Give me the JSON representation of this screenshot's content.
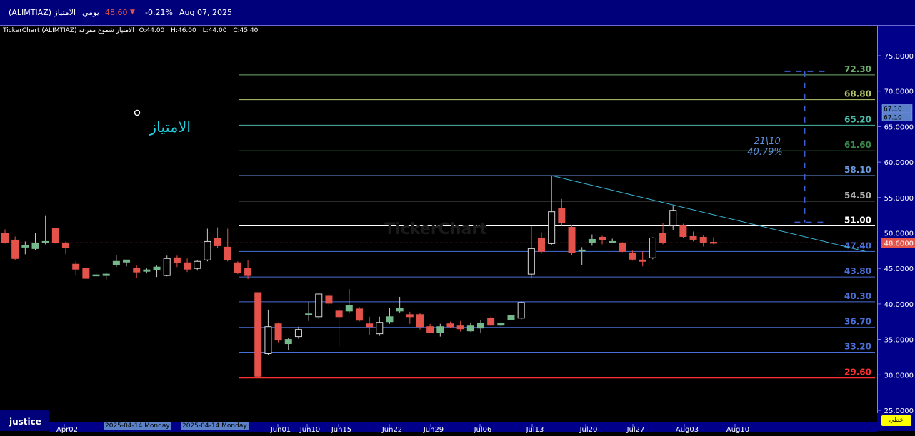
{
  "header": {
    "symbol": "(ALIMTIAZ) الامتياز",
    "period": "يومي",
    "price": "48.60",
    "change": "-0.21%",
    "date": "Aug 07, 2025"
  },
  "ohlc": {
    "brand": "TickerChart (ALIMTIAZ) الامتياز شموع مفرغة",
    "open": "O:44.00",
    "high": "H:46.00",
    "low": "L:44.00",
    "close": "C:45.40"
  },
  "watermark": "TickerChart",
  "chart_label": "الامتياز",
  "measure": {
    "bars": "21\\10",
    "pct": "40.79%"
  },
  "last_price_tag": "48.6000",
  "right_tags": [
    "67.10",
    "67.10"
  ],
  "footer": {
    "button": "justice",
    "corner_button": "خطي"
  },
  "date_boxes": [
    "2025-04-14 Monday",
    "2025-04-14 Monday"
  ],
  "colors": {
    "background": "#000000",
    "bar_blue": "#00007a",
    "up": "#74b98b",
    "down": "#e4534b",
    "price_tag": "#e4534b"
  },
  "chart_data": {
    "type": "candlestick",
    "ylim": [
      25,
      77
    ],
    "y_ticks": [
      "75.0000",
      "70.0000",
      "65.0000",
      "60.0000",
      "55.0000",
      "50.0000",
      "45.0000",
      "40.0000",
      "35.0000",
      "30.0000",
      "25.0000"
    ],
    "x_ticks": [
      "Apr02",
      "Jun01",
      "Jun10",
      "Jun15",
      "Jun22",
      "Jun29",
      "Jul06",
      "Jul13",
      "Jul20",
      "Jul27",
      "Aug03",
      "Aug10"
    ],
    "last_price": 48.6,
    "levels": [
      {
        "label": "72.30",
        "value": 72.3,
        "color": "#6fae6f"
      },
      {
        "label": "68.80",
        "value": 68.8,
        "color": "#b5c86a"
      },
      {
        "label": "65.20",
        "value": 65.2,
        "color": "#4ab8a8"
      },
      {
        "label": "61.60",
        "value": 61.6,
        "color": "#3a8a4a"
      },
      {
        "label": "58.10",
        "value": 58.1,
        "color": "#6a9ae0"
      },
      {
        "label": "54.50",
        "value": 54.5,
        "color": "#b0b0b0"
      },
      {
        "label": "51.00",
        "value": 51.0,
        "color": "#ffffff"
      },
      {
        "label": "47.40",
        "value": 47.4,
        "color": "#4a6ed8"
      },
      {
        "label": "43.80",
        "value": 43.8,
        "color": "#4a6ed8"
      },
      {
        "label": "40.30",
        "value": 40.3,
        "color": "#4a6ed8"
      },
      {
        "label": "36.70",
        "value": 36.7,
        "color": "#4a6ed8"
      },
      {
        "label": "33.20",
        "value": 33.2,
        "color": "#4a6ed8"
      },
      {
        "label": "29.60",
        "value": 29.6,
        "color": "#ff3030"
      }
    ],
    "candles": [
      {
        "o": 50.0,
        "h": 50.5,
        "l": 48.5,
        "c": 48.6
      },
      {
        "o": 49.0,
        "h": 49.5,
        "l": 46.2,
        "c": 46.4
      },
      {
        "o": 48.0,
        "h": 48.8,
        "l": 47.0,
        "c": 48.2
      },
      {
        "o": 47.8,
        "h": 50.0,
        "l": 47.6,
        "c": 48.6
      },
      {
        "o": 48.6,
        "h": 52.5,
        "l": 48.4,
        "c": 48.8
      },
      {
        "o": 50.6,
        "h": 50.6,
        "l": 48.5,
        "c": 48.6
      },
      {
        "o": 48.6,
        "h": 48.8,
        "l": 47.0,
        "c": 47.9
      },
      {
        "o": 45.6,
        "h": 46.0,
        "l": 44.0,
        "c": 44.9
      },
      {
        "o": 45.0,
        "h": 45.2,
        "l": 43.6,
        "c": 43.6
      },
      {
        "o": 44.0,
        "h": 44.6,
        "l": 43.8,
        "c": 44.1
      },
      {
        "o": 44.0,
        "h": 44.4,
        "l": 43.4,
        "c": 44.2
      },
      {
        "o": 45.5,
        "h": 46.9,
        "l": 45.2,
        "c": 46.0
      },
      {
        "o": 45.9,
        "h": 46.1,
        "l": 45.3,
        "c": 46.2
      },
      {
        "o": 45.0,
        "h": 45.4,
        "l": 43.6,
        "c": 44.5
      },
      {
        "o": 44.6,
        "h": 45.0,
        "l": 44.3,
        "c": 44.8
      },
      {
        "o": 44.8,
        "h": 45.4,
        "l": 43.8,
        "c": 45.2
      },
      {
        "o": 44.0,
        "h": 46.8,
        "l": 43.9,
        "c": 46.4
      },
      {
        "o": 46.5,
        "h": 46.8,
        "l": 45.2,
        "c": 45.8
      },
      {
        "o": 45.8,
        "h": 46.4,
        "l": 44.5,
        "c": 44.9
      },
      {
        "o": 45.0,
        "h": 46.2,
        "l": 44.7,
        "c": 46.0
      },
      {
        "o": 46.2,
        "h": 50.6,
        "l": 46.0,
        "c": 48.8
      },
      {
        "o": 49.2,
        "h": 50.8,
        "l": 47.9,
        "c": 48.2
      },
      {
        "o": 48.0,
        "h": 50.6,
        "l": 46.0,
        "c": 46.2
      },
      {
        "o": 45.8,
        "h": 46.0,
        "l": 44.2,
        "c": 44.4
      },
      {
        "o": 45.0,
        "h": 46.2,
        "l": 43.5,
        "c": 44.0
      },
      {
        "o": 41.6,
        "h": 41.6,
        "l": 29.6,
        "c": 29.8
      },
      {
        "o": 33.0,
        "h": 39.2,
        "l": 32.8,
        "c": 36.8
      },
      {
        "o": 37.2,
        "h": 37.4,
        "l": 34.6,
        "c": 34.9
      },
      {
        "o": 34.4,
        "h": 35.2,
        "l": 33.5,
        "c": 35.0
      },
      {
        "o": 35.4,
        "h": 36.8,
        "l": 35.1,
        "c": 36.4
      },
      {
        "o": 38.5,
        "h": 40.3,
        "l": 37.6,
        "c": 38.6
      },
      {
        "o": 38.2,
        "h": 41.5,
        "l": 37.9,
        "c": 41.4
      },
      {
        "o": 41.1,
        "h": 41.4,
        "l": 39.6,
        "c": 40.1
      },
      {
        "o": 39.0,
        "h": 39.6,
        "l": 34.0,
        "c": 38.2
      },
      {
        "o": 39.0,
        "h": 42.1,
        "l": 38.7,
        "c": 39.8
      },
      {
        "o": 39.3,
        "h": 39.6,
        "l": 37.5,
        "c": 37.7
      },
      {
        "o": 37.2,
        "h": 38.2,
        "l": 35.6,
        "c": 36.8
      },
      {
        "o": 35.8,
        "h": 38.2,
        "l": 35.5,
        "c": 37.4
      },
      {
        "o": 37.5,
        "h": 39.4,
        "l": 37.2,
        "c": 38.2
      },
      {
        "o": 39.0,
        "h": 41.0,
        "l": 38.8,
        "c": 39.4
      },
      {
        "o": 38.5,
        "h": 38.9,
        "l": 37.2,
        "c": 38.2
      },
      {
        "o": 38.5,
        "h": 38.7,
        "l": 36.4,
        "c": 36.8
      },
      {
        "o": 36.8,
        "h": 37.2,
        "l": 36.3,
        "c": 36.0
      },
      {
        "o": 36.0,
        "h": 37.2,
        "l": 35.4,
        "c": 36.8
      },
      {
        "o": 37.2,
        "h": 37.5,
        "l": 36.6,
        "c": 36.8
      },
      {
        "o": 36.9,
        "h": 37.6,
        "l": 36.1,
        "c": 36.5
      },
      {
        "o": 36.2,
        "h": 37.3,
        "l": 36.1,
        "c": 36.9
      },
      {
        "o": 36.6,
        "h": 37.7,
        "l": 35.9,
        "c": 37.3
      },
      {
        "o": 38.0,
        "h": 38.2,
        "l": 37.0,
        "c": 37.0
      },
      {
        "o": 37.0,
        "h": 37.4,
        "l": 36.8,
        "c": 37.3
      },
      {
        "o": 37.8,
        "h": 38.5,
        "l": 37.4,
        "c": 38.4
      },
      {
        "o": 38.0,
        "h": 40.4,
        "l": 37.8,
        "c": 40.2
      },
      {
        "o": 44.2,
        "h": 51.0,
        "l": 43.6,
        "c": 47.8
      },
      {
        "o": 49.3,
        "h": 50.1,
        "l": 47.1,
        "c": 47.4
      },
      {
        "o": 48.5,
        "h": 58.1,
        "l": 48.3,
        "c": 53.0
      },
      {
        "o": 53.5,
        "h": 54.8,
        "l": 51.0,
        "c": 51.5
      },
      {
        "o": 50.8,
        "h": 51.1,
        "l": 46.9,
        "c": 47.2
      },
      {
        "o": 47.6,
        "h": 48.0,
        "l": 45.5,
        "c": 47.6
      },
      {
        "o": 48.6,
        "h": 49.8,
        "l": 48.2,
        "c": 49.1
      },
      {
        "o": 49.4,
        "h": 49.6,
        "l": 48.4,
        "c": 49.0
      },
      {
        "o": 48.7,
        "h": 49.2,
        "l": 48.6,
        "c": 48.8
      },
      {
        "o": 48.6,
        "h": 48.7,
        "l": 47.3,
        "c": 47.4
      },
      {
        "o": 47.2,
        "h": 47.5,
        "l": 46.1,
        "c": 46.3
      },
      {
        "o": 46.2,
        "h": 47.4,
        "l": 45.3,
        "c": 46.0
      },
      {
        "o": 46.5,
        "h": 49.4,
        "l": 46.3,
        "c": 49.3
      },
      {
        "o": 50.0,
        "h": 51.4,
        "l": 48.4,
        "c": 48.6
      },
      {
        "o": 51.0,
        "h": 53.9,
        "l": 50.4,
        "c": 53.2
      },
      {
        "o": 51.0,
        "h": 51.3,
        "l": 49.3,
        "c": 49.5
      },
      {
        "o": 49.5,
        "h": 50.2,
        "l": 48.8,
        "c": 49.1
      },
      {
        "o": 49.4,
        "h": 49.7,
        "l": 48.1,
        "c": 48.6
      },
      {
        "o": 48.7,
        "h": 49.4,
        "l": 48.4,
        "c": 48.6
      }
    ],
    "trend_line": {
      "from": {
        "candle": 54,
        "value": 58.1
      },
      "to": {
        "candle": 85,
        "value": 47.4
      }
    },
    "measure_line": {
      "candle": 79,
      "from": 51.5,
      "to": 72.8
    }
  }
}
